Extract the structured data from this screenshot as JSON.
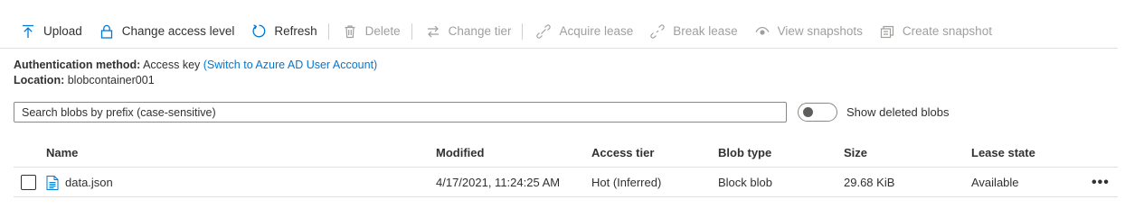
{
  "toolbar": {
    "upload": "Upload",
    "change_access": "Change access level",
    "refresh": "Refresh",
    "delete": "Delete",
    "change_tier": "Change tier",
    "acquire_lease": "Acquire lease",
    "break_lease": "Break lease",
    "view_snapshots": "View snapshots",
    "create_snapshot": "Create snapshot"
  },
  "info": {
    "auth_label": "Authentication method:",
    "auth_value": "Access key",
    "auth_link": "(Switch to Azure AD User Account)",
    "location_label": "Location:",
    "location_value": "blobcontainer001"
  },
  "search": {
    "placeholder": "Search blobs by prefix (case-sensitive)"
  },
  "toggle": {
    "label": "Show deleted blobs",
    "on": false
  },
  "columns": {
    "name": "Name",
    "modified": "Modified",
    "access_tier": "Access tier",
    "blob_type": "Blob type",
    "size": "Size",
    "lease_state": "Lease state"
  },
  "rows": [
    {
      "name": "data.json",
      "modified": "4/17/2021, 11:24:25 AM",
      "access_tier": "Hot (Inferred)",
      "blob_type": "Block blob",
      "size": "29.68 KiB",
      "lease_state": "Available",
      "more": "•••"
    }
  ],
  "colors": {
    "accent": "#0078d4",
    "text": "#323130",
    "disabled": "#a19f9d"
  }
}
